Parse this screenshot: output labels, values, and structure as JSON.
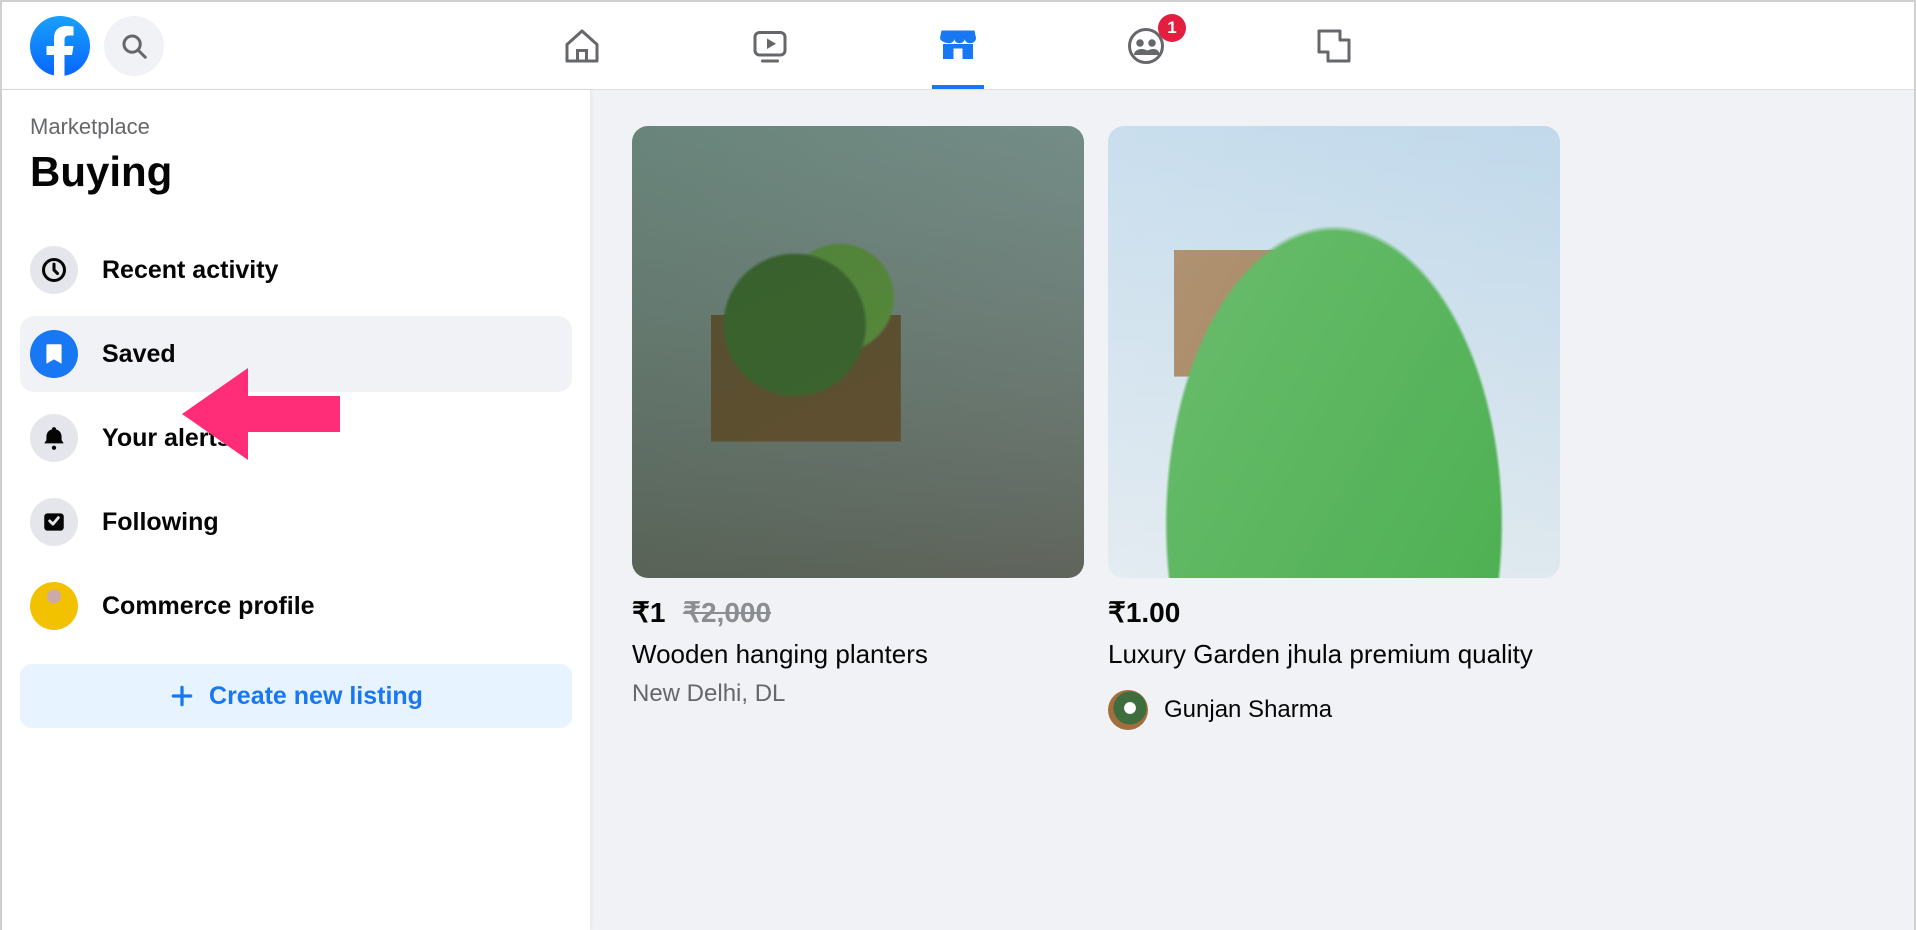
{
  "topnav": {
    "groups_badge": "1"
  },
  "sidebar": {
    "breadcrumb": "Marketplace",
    "title": "Buying",
    "items": [
      {
        "label": "Recent activity"
      },
      {
        "label": "Saved"
      },
      {
        "label": "Your alerts"
      },
      {
        "label": "Following"
      },
      {
        "label": "Commerce profile"
      }
    ],
    "create_label": "Create new listing"
  },
  "listings": [
    {
      "price": "₹1",
      "original_price": "₹2,000",
      "title": "Wooden hanging planters",
      "location": "New Delhi, DL"
    },
    {
      "price": "₹1.00",
      "title": "Luxury Garden jhula premium quality",
      "seller": "Gunjan Sharma"
    }
  ]
}
